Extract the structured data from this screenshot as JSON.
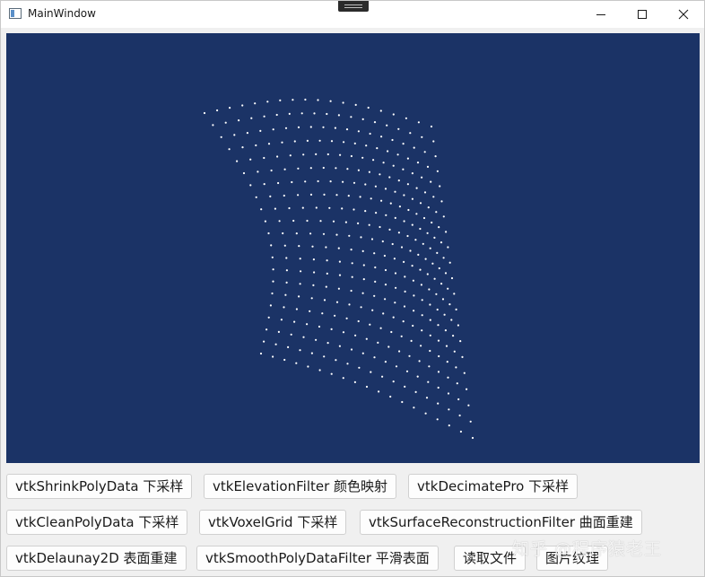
{
  "window": {
    "title": "MainWindow",
    "icons": {
      "app": "app-window-icon",
      "minimize": "minimize-icon",
      "maximize": "maximize-icon",
      "close": "close-icon"
    }
  },
  "viewport": {
    "background_color": "#1b3366",
    "point_color": "#ffffff",
    "content": "point-cloud"
  },
  "buttons": {
    "row1": [
      {
        "label": "vtkShrinkPolyData 下采样"
      },
      {
        "label": "vtkElevationFilter 颜色映射"
      },
      {
        "label": "vtkDecimatePro 下采样"
      }
    ],
    "row2": [
      {
        "label": "vtkCleanPolyData 下采样"
      },
      {
        "label": "vtkVoxelGrid 下采样"
      },
      {
        "label": "vtkSurfaceReconstructionFilter 曲面重建"
      }
    ],
    "row3": [
      {
        "label": "vtkDelaunay2D 表面重建"
      },
      {
        "label": "vtkSmoothPolyDataFilter 平滑表面"
      },
      {
        "label": "读取文件"
      },
      {
        "label": "图片纹理"
      }
    ]
  },
  "watermark": "知乎 @程序猿老王"
}
